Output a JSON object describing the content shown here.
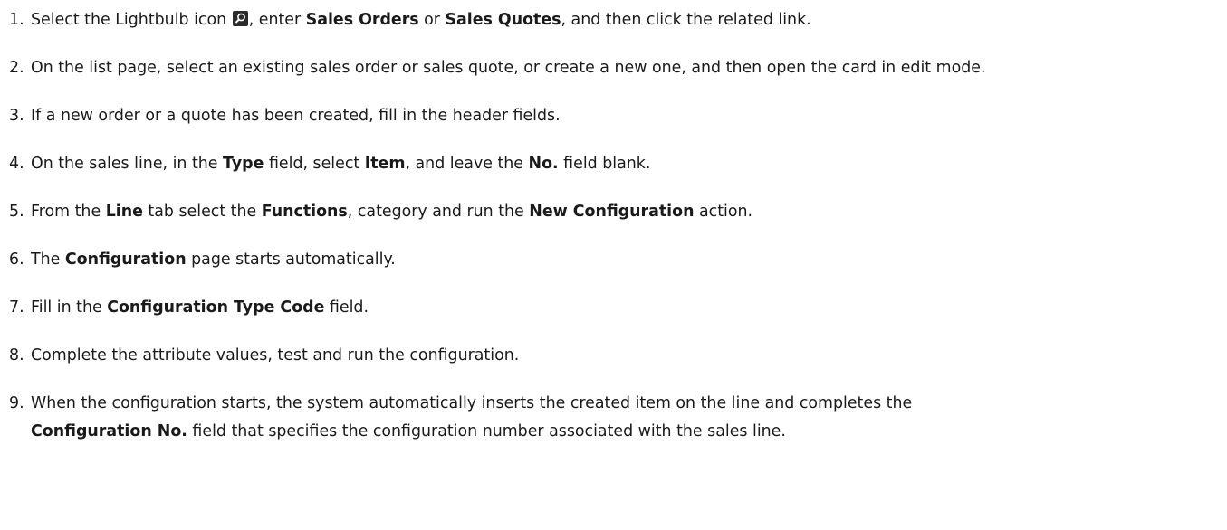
{
  "steps": [
    {
      "num": "1.",
      "t1": "Select the Lightbulb icon ",
      "icon": "search-icon",
      "t2": ", enter ",
      "b1": "Sales Orders",
      "t3": " or ",
      "b2": "Sales Quotes",
      "t4": ", and then click the related link."
    },
    {
      "num": "2.",
      "text": "On the list page, select an existing sales order or sales quote, or create a new one, and then open the card in edit mode."
    },
    {
      "num": "3.",
      "text": "If a new order or a quote has been created, fill in the header fields."
    },
    {
      "num": "4.",
      "t1": "On the sales line, in the ",
      "b1": "Type",
      "t2": " field, select ",
      "b2": "Item",
      "t3": ", and leave the ",
      "b3": "No.",
      "t4": " field blank."
    },
    {
      "num": "5.",
      "t1": "From the ",
      "b1": "Line",
      "t2": " tab select the ",
      "b2": "Functions",
      "t3": ", category and run the ",
      "b3": "New Configuration",
      "t4": " action."
    },
    {
      "num": "6.",
      "t1": "The ",
      "b1": "Configuration",
      "t2": " page starts automatically."
    },
    {
      "num": "7.",
      "t1": "Fill in the ",
      "b1": "Configuration Type Code",
      "t2": " field."
    },
    {
      "num": "8.",
      "text": "Complete the attribute values, test and run the configuration."
    },
    {
      "num": "9.",
      "t1": "When the configuration starts, the system automatically inserts the created item on the line and completes the",
      "b1": "Configuration No.",
      "t2": " field that specifies the configuration number associated with the sales line."
    }
  ]
}
